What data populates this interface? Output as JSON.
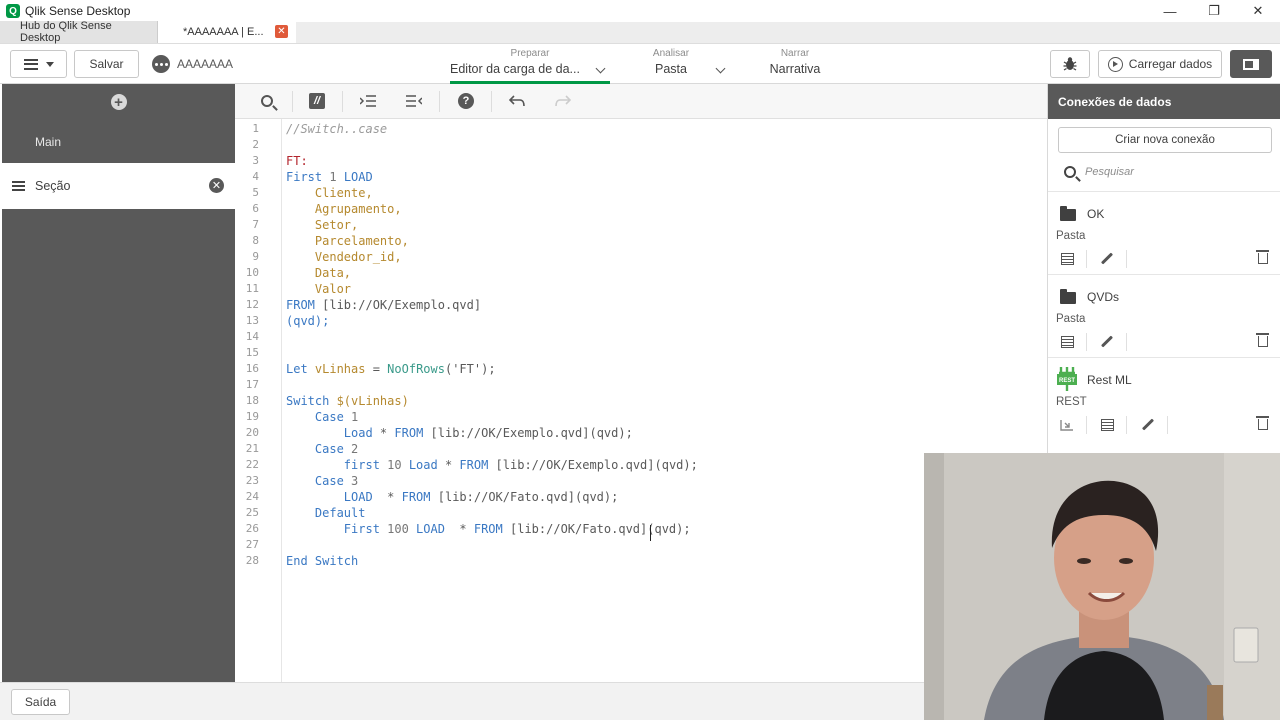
{
  "window": {
    "title": "Qlik Sense Desktop",
    "logo_letter": "Q",
    "minimize": "—",
    "maximize": "❐",
    "close": "✕"
  },
  "tabs": {
    "hub": "Hub do Qlik Sense Desktop",
    "active": "*AAAAAAA | E...",
    "close": "✕"
  },
  "toolbar": {
    "save_label": "Salvar",
    "app_name": "AAAAAAA",
    "nav": {
      "prepare_small": "Preparar",
      "prepare_big": "Editor da carga de da...",
      "analyze_small": "Analisar",
      "analyze_big": "Pasta",
      "narrate_small": "Narrar",
      "narrate_big": "Narrativa"
    },
    "load_data_label": "Carregar dados"
  },
  "sidebar": {
    "main_label": "Main",
    "section_label": "Seção"
  },
  "editor": {
    "line_numbers": [
      "1",
      "2",
      "3",
      "4",
      "5",
      "6",
      "7",
      "8",
      "9",
      "10",
      "11",
      "12",
      "13",
      "14",
      "15",
      "16",
      "17",
      "18",
      "19",
      "20",
      "21",
      "22",
      "23",
      "24",
      "25",
      "26",
      "27",
      "28"
    ],
    "code": {
      "l1": "//Switch..case",
      "l3": "FT:",
      "l4a": "First",
      "l4b": " 1 ",
      "l4c": "LOAD",
      "l5": "    Cliente,",
      "l6": "    Agrupamento,",
      "l7": "    Setor,",
      "l8": "    Parcelamento,",
      "l9": "    Vendedor_id,",
      "l10": "    Data,",
      "l11": "    Valor",
      "l12a": "FROM",
      "l12b": " [lib://OK/Exemplo.qvd]",
      "l13": "(qvd);",
      "l16a": "Let",
      "l16b": " vLinhas",
      "l16c": " = ",
      "l16d": "NoOfRows",
      "l16e": "('FT');",
      "l18a": "Switch",
      "l18b": " $(vLinhas)",
      "l19a": "    Case",
      "l19b": " 1",
      "l20a": "        Load",
      "l20b": " * ",
      "l20c": "FROM",
      "l20d": " [lib://OK/Exemplo.qvd](qvd);",
      "l21a": "    Case",
      "l21b": " 2",
      "l22a": "        first",
      "l22b": " 10 ",
      "l22c": "Load",
      "l22d": " * ",
      "l22e": "FROM",
      "l22f": " [lib://OK/Exemplo.qvd](qvd);",
      "l23a": "    Case",
      "l23b": " 3",
      "l24a": "        LOAD",
      "l24b": "  * ",
      "l24c": "FROM",
      "l24d": " [lib://OK/Fato.qvd](qvd);",
      "l25a": "    Default",
      "l26a": "        First",
      "l26b": " 100 ",
      "l26c": "LOAD",
      "l26d": "  * ",
      "l26e": "FROM",
      "l26f": " [lib://OK/Fato.qvd](qvd);",
      "l28": "End Switch"
    }
  },
  "connections": {
    "header": "Conexões de dados",
    "create_label": "Criar nova conexão",
    "search_placeholder": "Pesquisar",
    "items": [
      {
        "name": "OK",
        "type": "Pasta"
      },
      {
        "name": "QVDs",
        "type": "Pasta"
      },
      {
        "name": "Rest ML",
        "type": "REST",
        "logo_text": "REST"
      }
    ]
  },
  "bottom": {
    "exit_label": "Saída"
  },
  "colors": {
    "accent_green": "#009845",
    "sidebar_dark": "#595959",
    "keyword_blue": "#3a78c3",
    "field_gold": "#b5892e"
  }
}
